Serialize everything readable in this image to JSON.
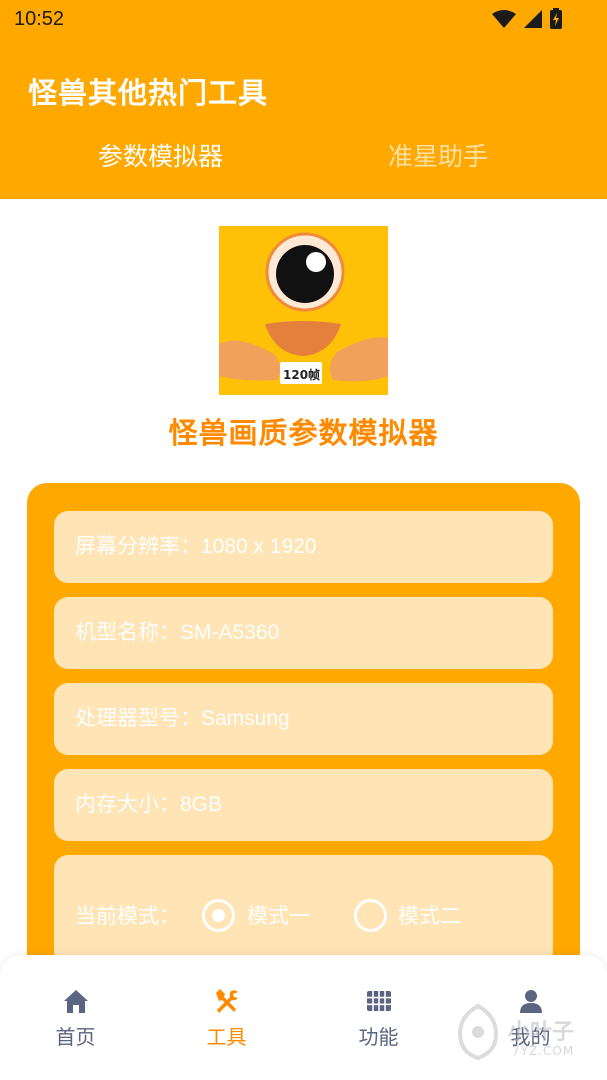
{
  "status_bar": {
    "time": "10:52"
  },
  "header": {
    "title": "怪兽其他热门工具",
    "tabs": [
      {
        "label": "参数模拟器",
        "active": true
      },
      {
        "label": "准星助手",
        "active": false
      }
    ]
  },
  "logo": {
    "badge_text": "120帧"
  },
  "main": {
    "subtitle": "怪兽画质参数模拟器",
    "fields": [
      {
        "text": "屏幕分辨率：1080 x 1920"
      },
      {
        "text": "机型名称：SM-A5360"
      },
      {
        "text": "处理器型号：Samsung"
      },
      {
        "text": "内存大小：8GB"
      }
    ],
    "mode": {
      "label": "当前模式：",
      "options": [
        {
          "label": "模式一",
          "selected": true
        },
        {
          "label": "模式二",
          "selected": false
        }
      ]
    }
  },
  "bottom_nav": {
    "items": [
      {
        "label": "首页",
        "icon": "home-icon",
        "active": false
      },
      {
        "label": "工具",
        "icon": "tools-icon",
        "active": true
      },
      {
        "label": "功能",
        "icon": "grid-icon",
        "active": false
      },
      {
        "label": "我的",
        "icon": "user-icon",
        "active": false
      }
    ]
  },
  "watermark": {
    "text": "小叶子",
    "sub": "7YZ.COM"
  },
  "colors": {
    "primary": "#FFA800",
    "accent_text": "#FF8A00",
    "field_bg": "#FFE4B5",
    "nav_inactive": "#5b6480"
  }
}
